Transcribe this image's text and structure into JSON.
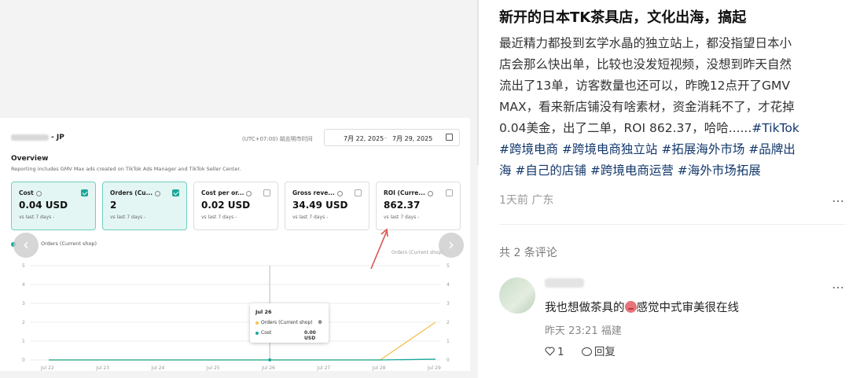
{
  "image": {
    "shop_suffix": "- JP",
    "timezone": "(UTC+07:00) 胡志明市时间",
    "date_start": "7月 22, 2025",
    "date_sep": "-",
    "date_end": "7月 29, 2025",
    "overview_title": "Overview",
    "overview_sub": "Reporting includes GMV Max ads created on TikTok Ads Manager and TikTok Seller Center.",
    "cards": [
      {
        "label": "Cost",
        "value": "0.04 USD",
        "vs": "vs last 7 days -",
        "checked": true
      },
      {
        "label": "Orders (Cu...",
        "value": "2",
        "vs": "vs last 7 days -",
        "checked": true
      },
      {
        "label": "Cost per or...",
        "value": "0.02 USD",
        "vs": "vs last 7 days -",
        "checked": false
      },
      {
        "label": "Gross reve...",
        "value": "34.49 USD",
        "vs": "vs last 7 days -",
        "checked": false
      },
      {
        "label": "ROI (Curre...",
        "value": "862.37",
        "vs": "vs last 7 days -",
        "checked": false
      }
    ],
    "legend": "Orders (Current shop)",
    "right_axis_label": "Orders (Current shop)",
    "tooltip": {
      "title": "Jul 26",
      "row1_label": "Orders (Current shop)",
      "row1_value": "0",
      "row2_label": "Cost",
      "row2_value": "0.00 USD"
    },
    "colors": {
      "orders": "#f2c14e",
      "cost": "#1aa89a",
      "arrow": "#d9534f"
    }
  },
  "chart_data": {
    "type": "line",
    "x": [
      "Jul 22",
      "Jul 23",
      "Jul 24",
      "Jul 25",
      "Jul 26",
      "Jul 27",
      "Jul 28",
      "Jul 29"
    ],
    "series": [
      {
        "name": "Orders (Current shop)",
        "values": [
          0,
          0,
          0,
          0,
          0,
          0,
          0,
          2
        ]
      },
      {
        "name": "Cost",
        "values": [
          0,
          0,
          0,
          0,
          0,
          0,
          0,
          0.04
        ]
      }
    ],
    "ylim": [
      0,
      5
    ],
    "yticks": [
      "0",
      "1",
      "2",
      "3",
      "4",
      "5"
    ],
    "x_tick_labels": [
      "Jul 22",
      "Jul 23",
      "Jul 24",
      "Jul 25",
      "Jul 26",
      "Jul 27",
      "Jul 28",
      "Jul 29"
    ],
    "highlight": "Jul 26"
  },
  "post": {
    "title": "新开的日本TK茶具店，文化出海，搞起",
    "body_lines": [
      "最近精力都投到玄学水晶的独立站上，都没指望日本小",
      "店会那么快出单，比较也没发短视频，没想到昨天自然",
      "流出了13单，访客数量也还可以，昨晚12点开了GMV",
      "MAX，看来新店铺没有啥素材，资金消耗不了，才花掉"
    ],
    "body_line5_text": "0.04美金，出了二单，ROI 862.37，哈哈......",
    "tags_line5": "#TikTok",
    "tags_line6": "#跨境电商 #跨境电商独立站 #拓展海外市场 #品牌出",
    "tags_line7": "海 #自己的店铺 #跨境电商运营 #海外市场拓展",
    "meta": "1天前 广东",
    "more_icon": "…",
    "comments_count": "共 2 条评论"
  },
  "comment": {
    "text_before_emoji": "我也想做茶具的",
    "text_after_emoji": "感觉中式审美很在线",
    "meta": "昨天 23:21 福建",
    "likes": "1",
    "reply_label": "回复",
    "more_icon": "…"
  }
}
